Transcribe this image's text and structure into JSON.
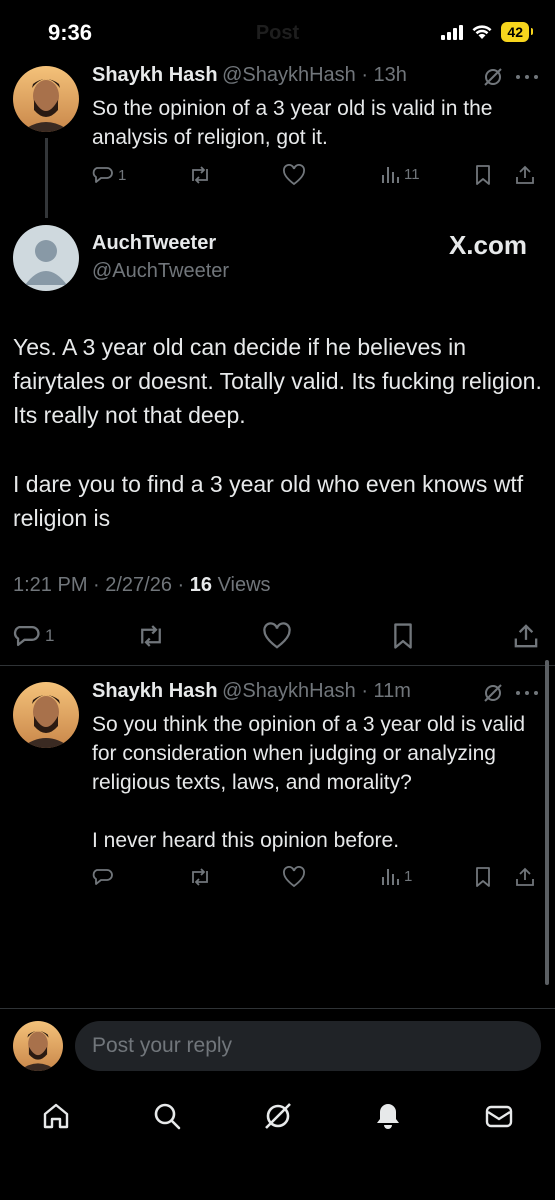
{
  "status_bar": {
    "time": "9:36",
    "battery": "42"
  },
  "header": {
    "title": "Post"
  },
  "parent_tweet": {
    "name": "Shaykh Hash",
    "handle": "@ShaykhHash",
    "time": "13h",
    "text": "So the opinion of a 3 year old is valid in the analysis of religion, got it.",
    "reply_count": "1",
    "views": "11"
  },
  "main_tweet": {
    "name": "AuchTweeter",
    "handle": "@AuchTweeter",
    "watermark": "X.com",
    "paragraph1": "Yes. A 3 year old can decide if he believes in fairytales or doesnt. Totally valid. Its fucking religion. Its really not that deep.",
    "paragraph2": "I dare you to find a 3 year old who even knows wtf religion is",
    "timestamp": "1:21 PM · 2/27/26 · ",
    "views_count": "16",
    "views_label": " Views",
    "reply_count": "1"
  },
  "reply_tweet": {
    "name": "Shaykh Hash",
    "handle": "@ShaykhHash",
    "time": "11m",
    "text": "So you think the opinion of a 3 year old is valid for consideration when judging or analyzing religious texts, laws, and morality?",
    "text2": "I never heard this opinion before.",
    "views": "1"
  },
  "reply_bar": {
    "placeholder": "Post your reply"
  },
  "colors": {
    "background": "#000000",
    "text": "#e7e9ea",
    "muted": "#71767b",
    "battery": "#f7d51d"
  }
}
